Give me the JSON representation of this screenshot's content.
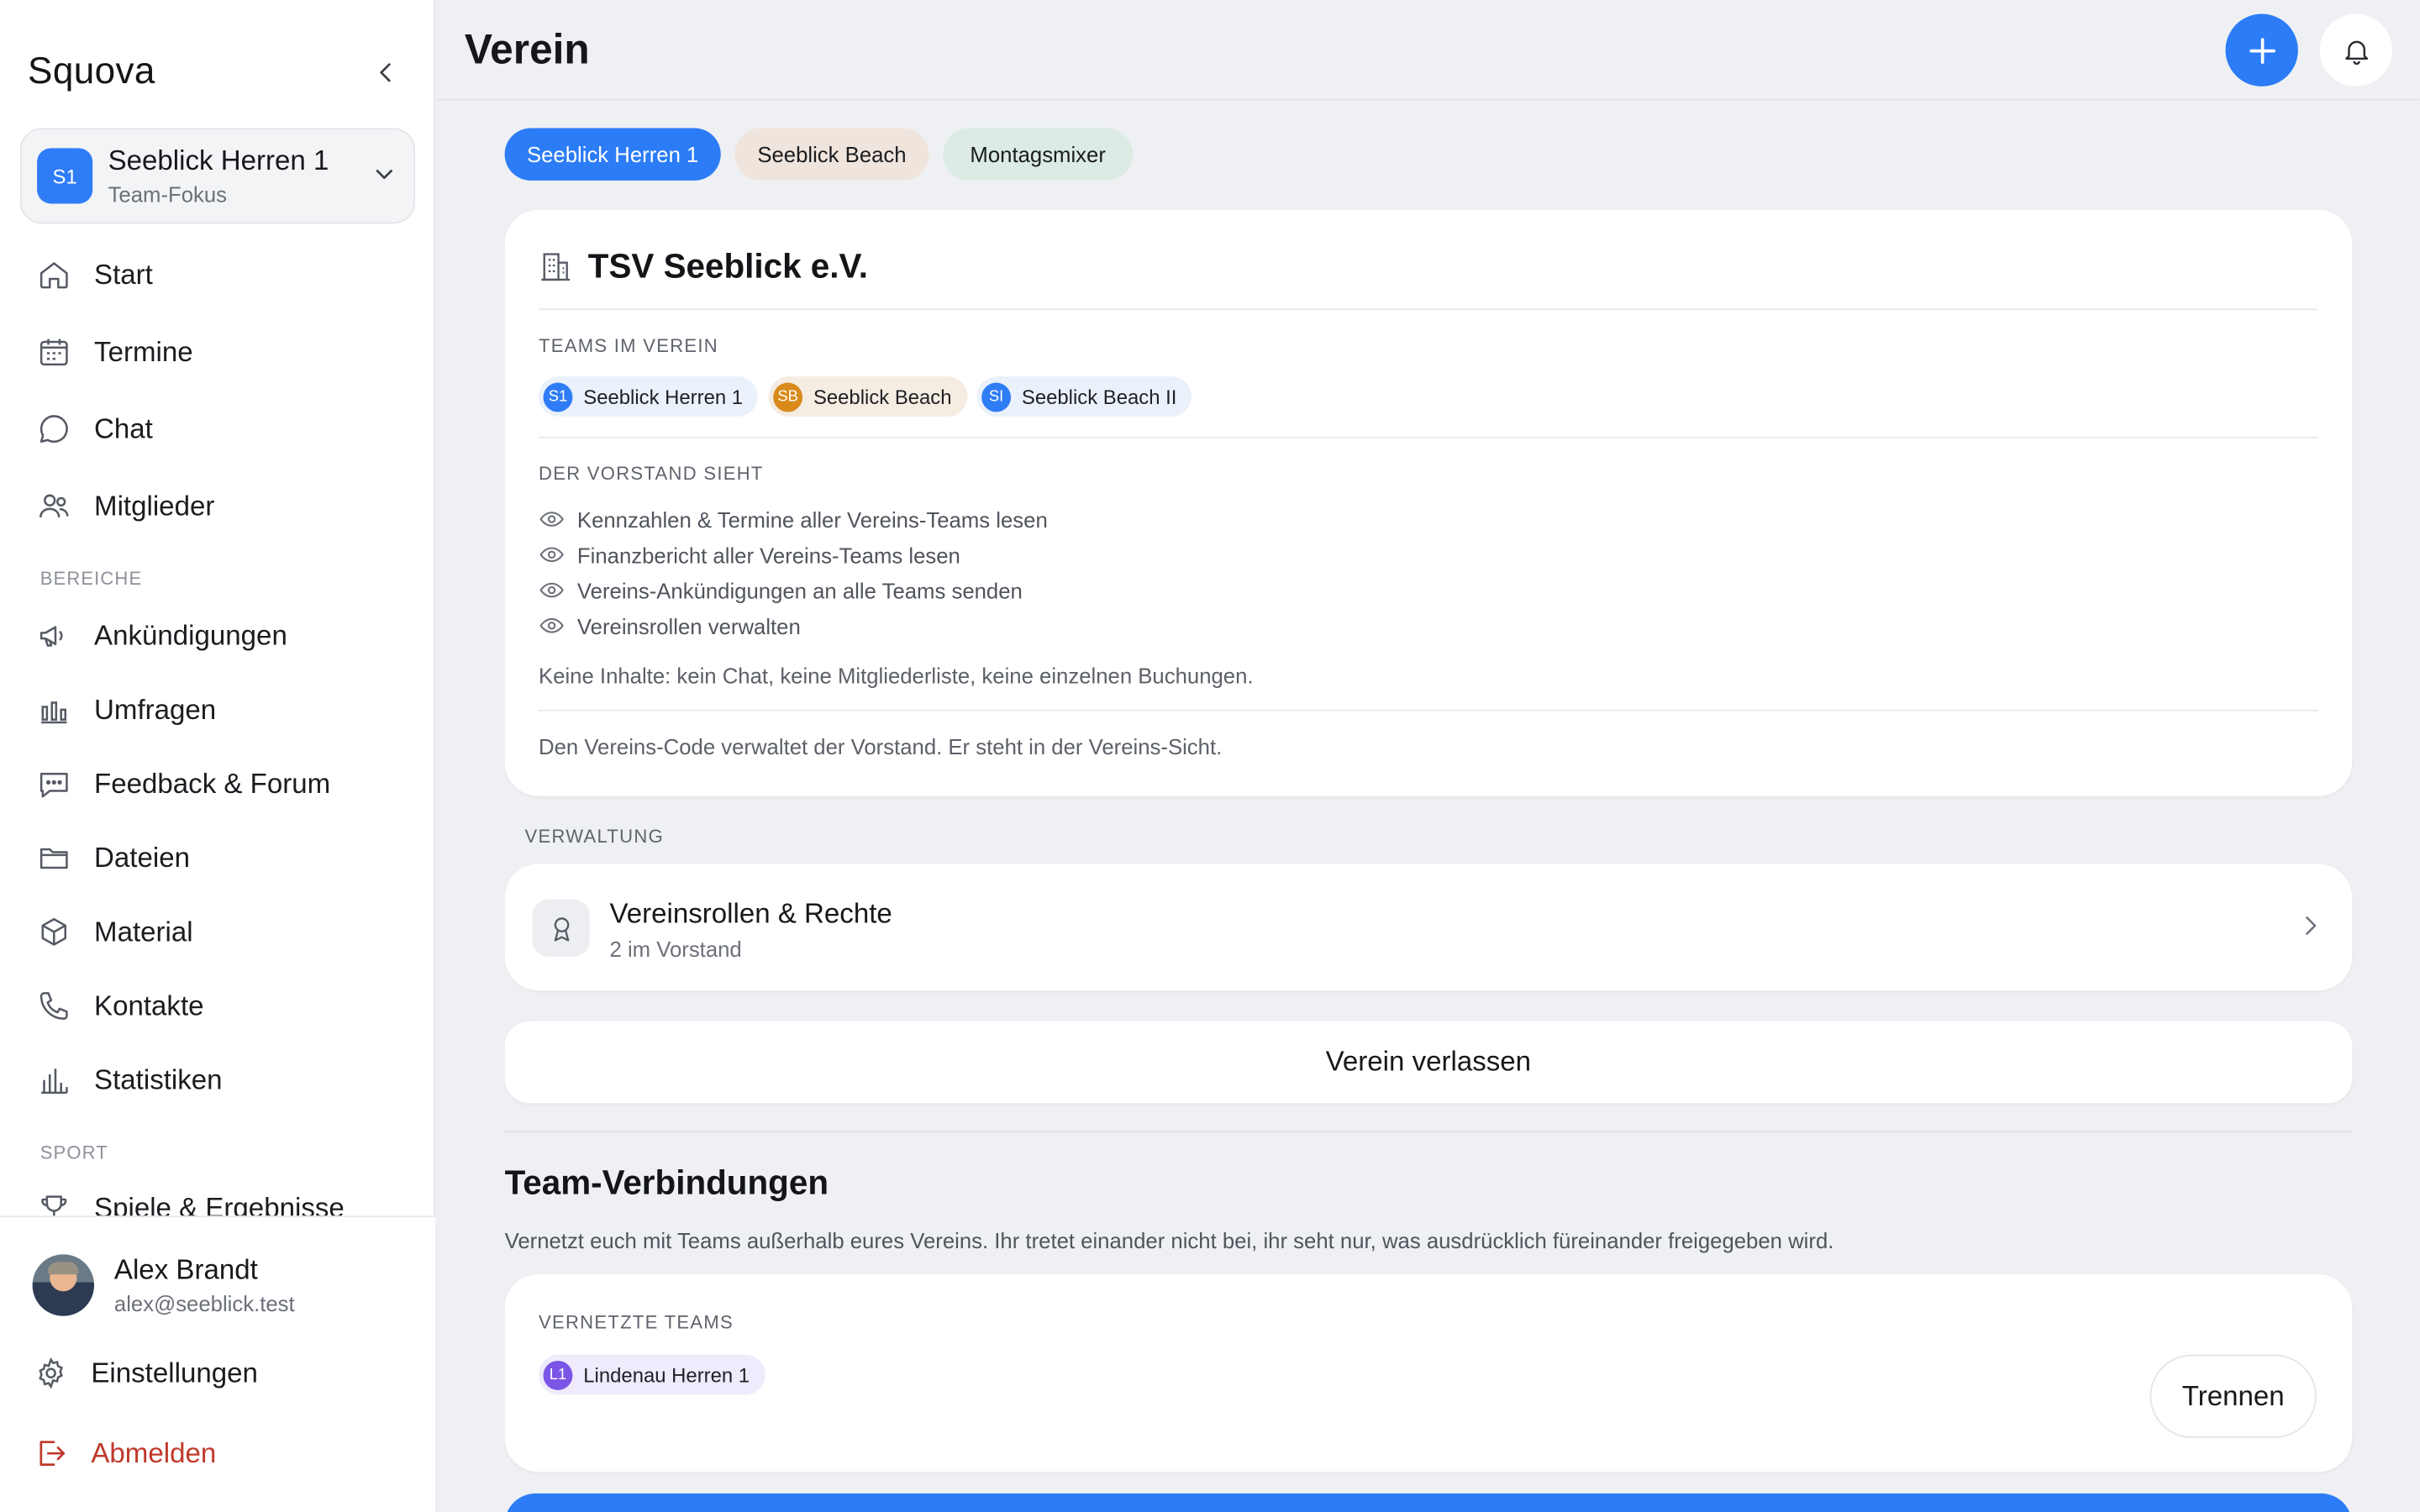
{
  "app": {
    "brand": "Squova",
    "page_title": "Verein"
  },
  "sidebar": {
    "team": {
      "initials": "S1",
      "name": "Seeblick Herren 1",
      "subtitle": "Team-Fokus"
    },
    "items": [
      {
        "label": "Start",
        "icon": "home-icon"
      },
      {
        "label": "Termine",
        "icon": "calendar-icon"
      },
      {
        "label": "Chat",
        "icon": "chat-bubble-icon"
      },
      {
        "label": "Mitglieder",
        "icon": "users-icon"
      }
    ],
    "section_bereiche": "BEREICHE",
    "bereiche": [
      {
        "label": "Ankündigungen",
        "icon": "megaphone-icon"
      },
      {
        "label": "Umfragen",
        "icon": "bar-chart-icon"
      },
      {
        "label": "Feedback & Forum",
        "icon": "message-dots-icon"
      },
      {
        "label": "Dateien",
        "icon": "folder-icon"
      },
      {
        "label": "Material",
        "icon": "box-icon"
      },
      {
        "label": "Kontakte",
        "icon": "phone-icon"
      },
      {
        "label": "Statistiken",
        "icon": "stats-icon"
      }
    ],
    "section_sport": "SPORT",
    "sport": [
      {
        "label": "Spiele & Ergebnisse",
        "icon": "trophy-icon"
      }
    ],
    "user": {
      "name": "Alex Brandt",
      "email": "alex@seeblick.test"
    },
    "settings_label": "Einstellungen",
    "logout_label": "Abmelden"
  },
  "chips": [
    {
      "label": "Seeblick Herren 1",
      "active": true
    },
    {
      "label": "Seeblick Beach",
      "active": false
    },
    {
      "label": "Montagsmixer",
      "active": false
    }
  ],
  "club": {
    "name": "TSV Seeblick e.V.",
    "teams_label": "TEAMS IM VEREIN",
    "teams": [
      {
        "initials": "S1",
        "name": "Seeblick Herren 1",
        "color": "#2f7df6",
        "bg": "#eaf1fb"
      },
      {
        "initials": "SB",
        "name": "Seeblick Beach",
        "color": "#d98a1a",
        "bg": "#f5ece2"
      },
      {
        "initials": "SI",
        "name": "Seeblick Beach II",
        "color": "#2f7df6",
        "bg": "#eaf1fb"
      }
    ],
    "board_label": "DER VORSTAND SIEHT",
    "permissions": [
      "Kennzahlen & Termine aller Vereins-Teams lesen",
      "Finanzbericht aller Vereins-Teams lesen",
      "Vereins-Ankündigungen an alle Teams senden",
      "Vereinsrollen verwalten"
    ],
    "no_content_note": "Keine Inhalte: kein Chat, keine Mitgliederliste, keine einzelnen Buchungen.",
    "code_note": "Den Vereins-Code verwaltet der Vorstand. Er steht in der Vereins-Sicht."
  },
  "verwaltung": {
    "label": "VERWALTUNG",
    "roles_title": "Vereinsrollen & Rechte",
    "roles_sub": "2 im Vorstand"
  },
  "leave_label": "Verein verlassen",
  "connections": {
    "title": "Team-Verbindungen",
    "description": "Vernetzt euch mit Teams außerhalb eures Vereins. Ihr tretet einander nicht bei, ihr seht nur, was ausdrücklich füreinander freigegeben wird.",
    "label": "VERNETZTE TEAMS",
    "teams": [
      {
        "initials": "L1",
        "name": "Lindenau Herren 1",
        "color": "#7a55e6",
        "bg": "#efeafc"
      }
    ],
    "disconnect_label": "Trennen"
  },
  "colors": {
    "accent": "#2b7cf6",
    "danger": "#c0392b",
    "background": "#eef0f3"
  }
}
